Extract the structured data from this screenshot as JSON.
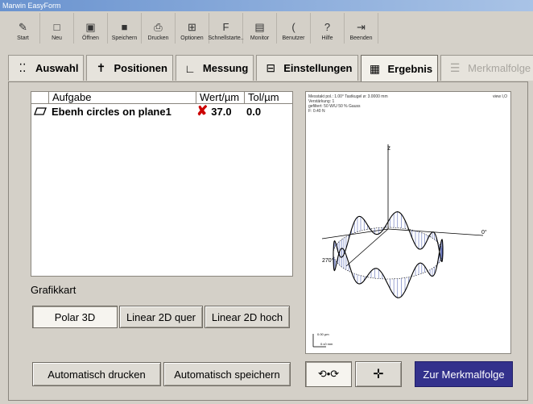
{
  "window": {
    "title": "Marwin EasyForm"
  },
  "toolbar": [
    {
      "label": "Start",
      "icon": "✎"
    },
    {
      "label": "Neu",
      "icon": "□"
    },
    {
      "label": "Öffnen",
      "icon": "▣"
    },
    {
      "label": "Speichern",
      "icon": "■"
    },
    {
      "label": "Drucken",
      "icon": "⎙"
    },
    {
      "label": "Optionen",
      "icon": "⊞"
    },
    {
      "label": "Schnellstarte..",
      "icon": "F"
    },
    {
      "label": "Monitor",
      "icon": "▤"
    },
    {
      "label": "Benutzer",
      "icon": "("
    },
    {
      "label": "Hilfe",
      "icon": "?"
    },
    {
      "label": "Beenden",
      "icon": "⇥"
    }
  ],
  "tabs": [
    {
      "label": "Auswahl",
      "icon": "⁚⁚",
      "state": "normal"
    },
    {
      "label": "Positionen",
      "icon": "✝",
      "state": "normal"
    },
    {
      "label": "Messung",
      "icon": "∟",
      "state": "normal"
    },
    {
      "label": "Einstellungen",
      "icon": "⊟",
      "state": "normal"
    },
    {
      "label": "Ergebnis",
      "icon": "▦",
      "state": "active"
    },
    {
      "label": "Merkmalfolge",
      "icon": "☰",
      "state": "disabled"
    }
  ],
  "results": {
    "headers": [
      "",
      "Aufgabe",
      "Wert/µm",
      "Tol/µm"
    ],
    "rows": [
      {
        "task": "Ebenh circles on plane1",
        "value": "37.0",
        "tol": "0.0",
        "status": "fail"
      }
    ]
  },
  "grafik": {
    "label": "Grafikkart",
    "buttons": [
      "Polar 3D",
      "Linear 2D quer",
      "Linear 2D hoch"
    ],
    "selected": "Polar 3D"
  },
  "actions": {
    "print": "Automatisch drucken",
    "save": "Automatisch speichern",
    "zur": "Zur Merkmalfolge"
  },
  "graph": {
    "info_line1": "Messtakt pol.: 1.00° Tastkugel ø: 3.0000 mm",
    "info_line2": "Verstärkung: 1",
    "info_line3": "gefiltert: 50 W/U 50 % Gauss",
    "info_line4": "F: 0.40 N",
    "info_right": "view I,O",
    "axis_z": "z",
    "label_0": "0°",
    "label_270": "270°",
    "scale_1": "0.00 µm",
    "scale_2": "0.v0 mm"
  },
  "colors": {
    "accent": "#33318c",
    "fail": "#cc0000",
    "profile": "#3a4ea8"
  }
}
